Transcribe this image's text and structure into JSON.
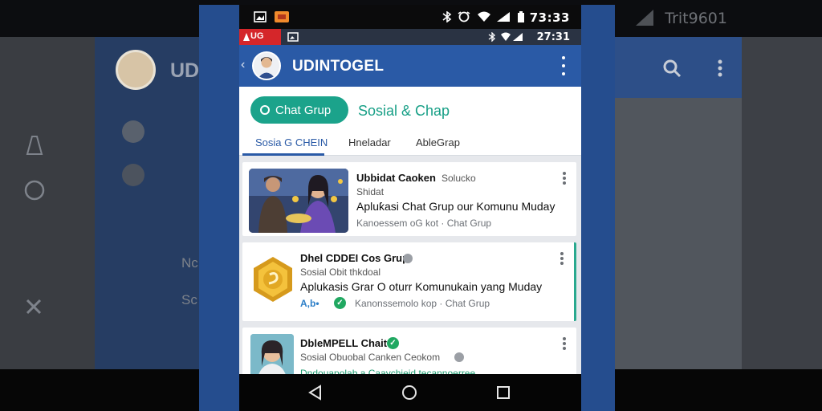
{
  "status_bar": {
    "time": "73:33",
    "icons": [
      "image-icon",
      "notification-icon",
      "bluetooth-icon",
      "alarm-icon",
      "wifi-icon",
      "signal-icon",
      "battery-icon"
    ]
  },
  "sub_status_bar": {
    "badge": "UG",
    "time": "27:31",
    "accent": "#d5262a"
  },
  "background": {
    "title": "UD",
    "letter": "D",
    "clock": "Trit9601",
    "side_text": "Nc",
    "side_text_2": "Sc"
  },
  "app_bar": {
    "title": "UDINTOGEL",
    "color": "#2a5aa6"
  },
  "header": {
    "chip_label": "Chat Grup",
    "section_title": "Sosial & Chap",
    "accent": "#1ba38b"
  },
  "tabs": [
    {
      "label": "Sosia G CHEIN",
      "active": true
    },
    {
      "label": "Hneladar",
      "active": false
    },
    {
      "label": "AbleGrap",
      "active": false
    }
  ],
  "cards": [
    {
      "name": "Ubbidat Caoken",
      "name_suffix": "Solucko",
      "subtitle": "Shidat",
      "description": "Apluƙasi Chat Grup our Komunu Muday",
      "meta": "Kanoessem oG kot · Chat Grup"
    },
    {
      "name": "Dhel CDDEI Cos Grup",
      "subtitle": "Sosial Obit thkdoal",
      "description": "Aplukasis Grar O oturr Komunukain yang Muday",
      "rating": "A,b•",
      "meta": "Kanonssemolo kop · Chat Grup"
    },
    {
      "name": "DbleMPELL Chait",
      "subtitle": "Sosial Obuobal Canken Ceokom",
      "meta": "Dndouapolab a Caaychieid tecannoerree"
    }
  ]
}
